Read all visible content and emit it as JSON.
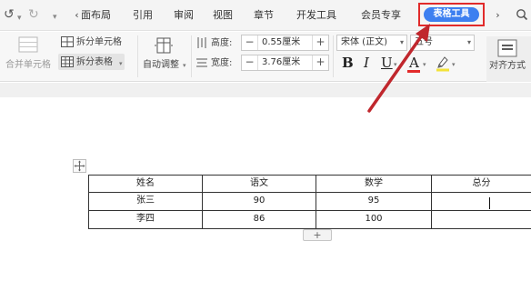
{
  "tabs": {
    "undo": "↺",
    "redo": "↻",
    "more": "▾",
    "items": [
      "页面布局",
      "引用",
      "审阅",
      "视图",
      "章节",
      "开发工具",
      "会员专享"
    ],
    "active": "表格工具",
    "nav_left": "‹",
    "nav_right": "›"
  },
  "ribbon": {
    "merge_cells": "合并单元格",
    "split_cells": "拆分单元格",
    "split_table": "拆分表格",
    "auto_fit": "自动调整",
    "height_label": "高度:",
    "height_value": "0.55厘米",
    "width_label": "宽度:",
    "width_value": "3.76厘米",
    "font_name": "宋体 (正文)",
    "font_size": "五号",
    "bold": "B",
    "italic": "I",
    "underline": "U",
    "font_color": "A",
    "align": "对齐方式",
    "minus": "−",
    "plus": "+"
  },
  "table": {
    "headers": [
      "姓名",
      "语文",
      "数学",
      "总分"
    ],
    "rows": [
      [
        "张三",
        "90",
        "95",
        ""
      ],
      [
        "李四",
        "86",
        "100",
        ""
      ]
    ],
    "add_row": "+"
  },
  "colors": {
    "active_tab": "#3d7ff0",
    "highlight_border": "#e12a2a",
    "arrow": "#c0272d"
  },
  "icons": [
    "undo-icon",
    "redo-icon",
    "search-icon",
    "merge-cells-icon",
    "split-cells-icon",
    "split-table-icon",
    "auto-fit-icon",
    "row-height-icon",
    "column-width-icon",
    "font-color-icon",
    "highlight-icon",
    "align-icon",
    "table-move-handle-icon",
    "annotation-arrow"
  ]
}
